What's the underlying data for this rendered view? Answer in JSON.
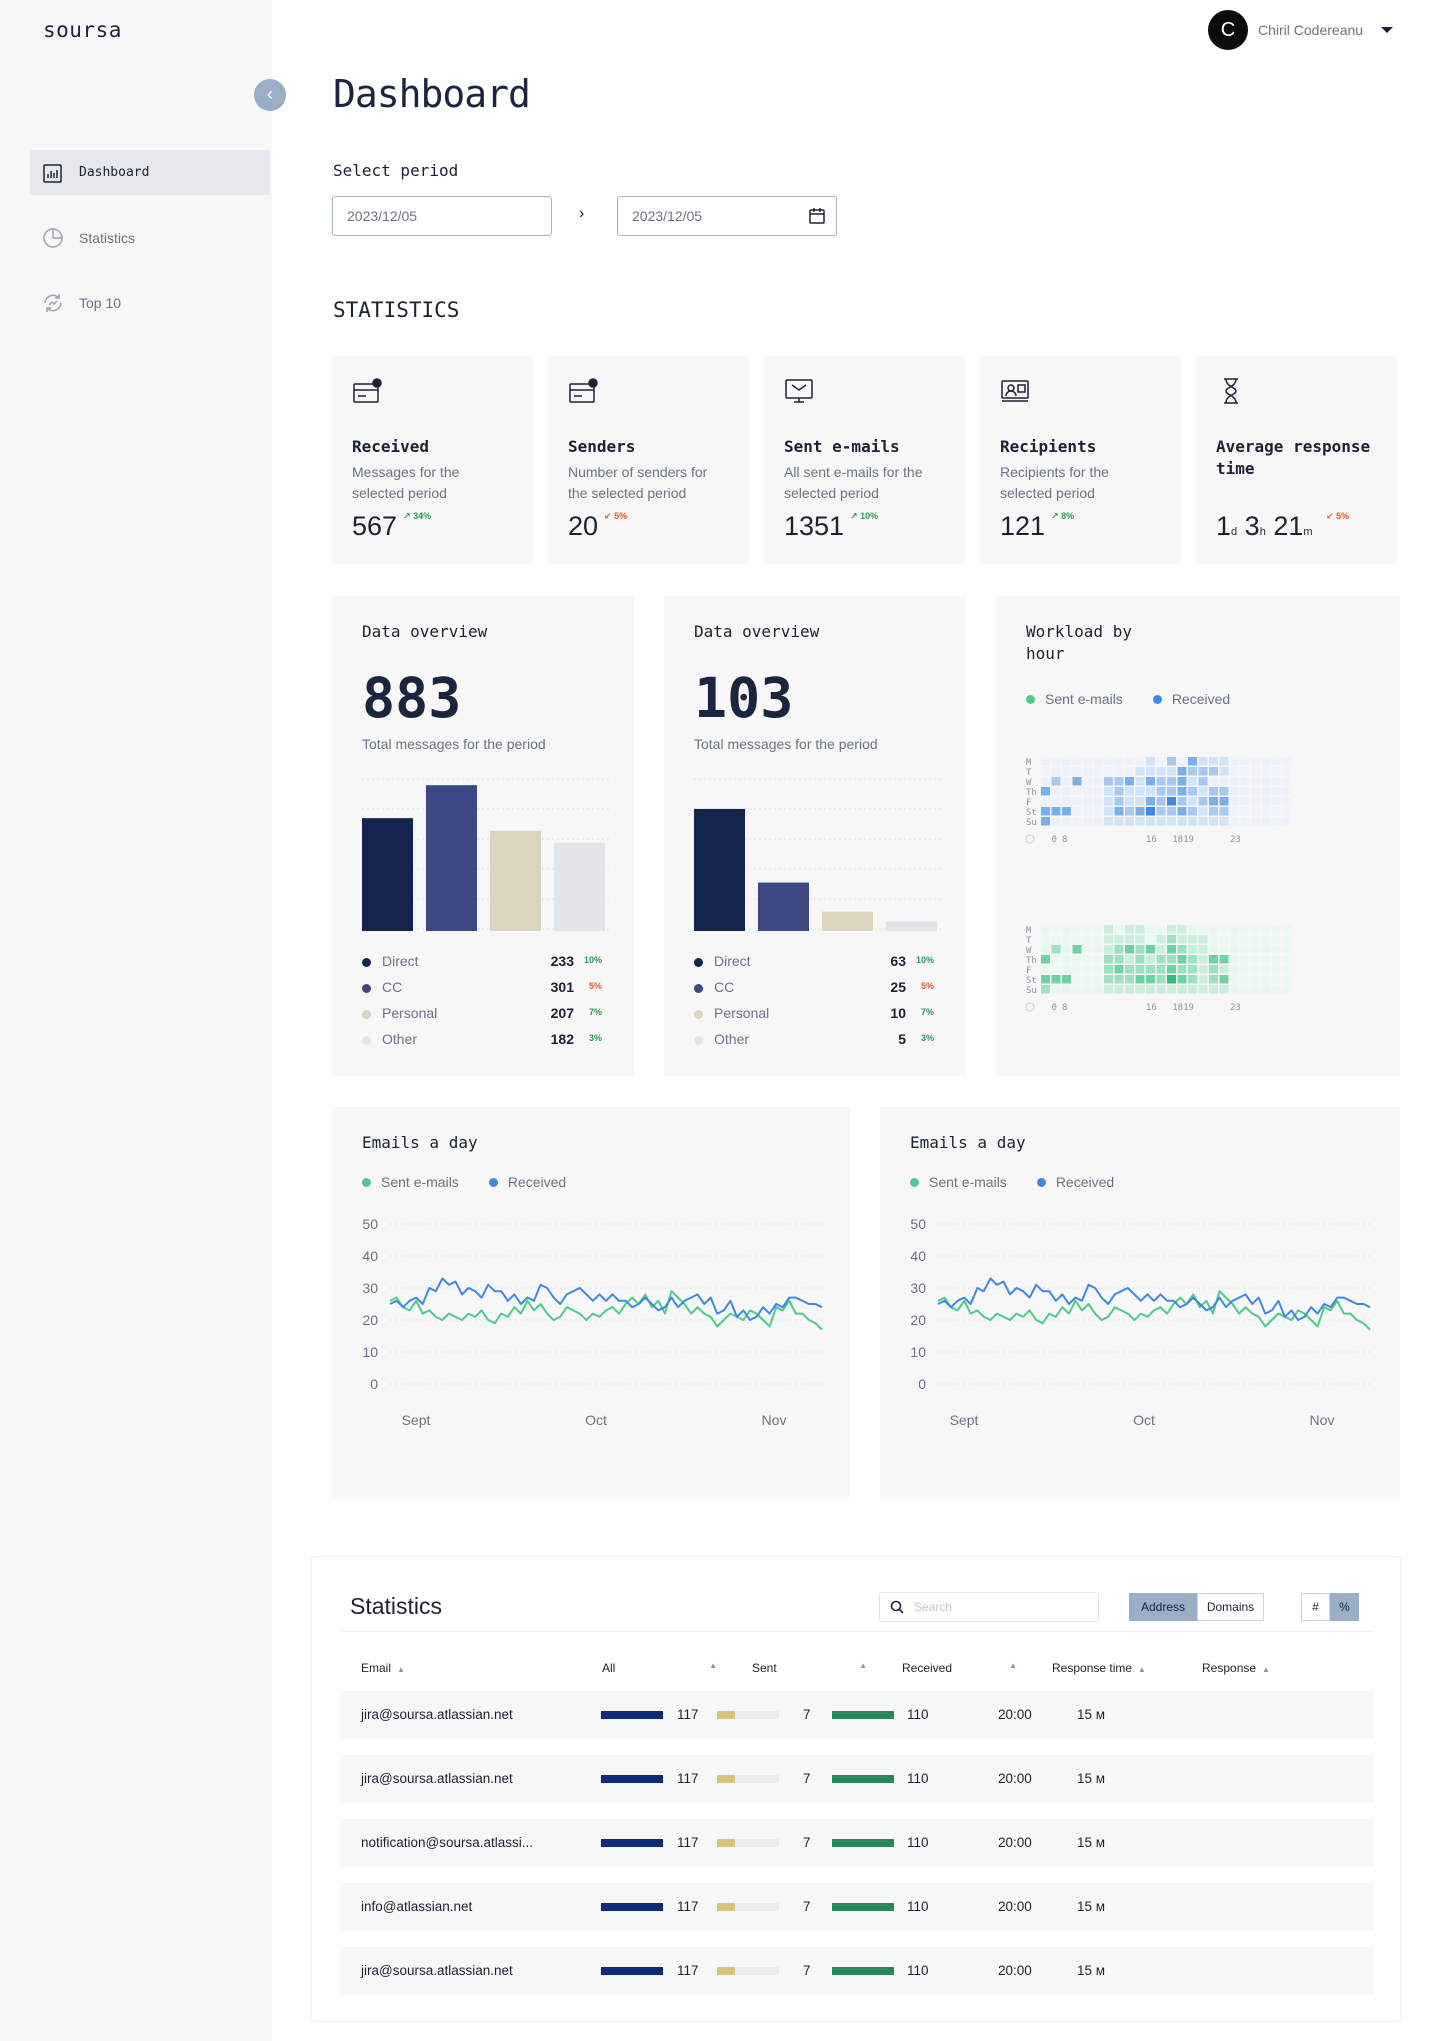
{
  "app": {
    "logo": "soursa",
    "user_initial": "C",
    "user_name": "Chiril Codereanu"
  },
  "sidebar": {
    "items": [
      {
        "label": "Dashboard",
        "icon": "report-icon"
      },
      {
        "label": "Statistics",
        "icon": "pie-chart-icon"
      },
      {
        "label": "Top 10",
        "icon": "refresh-chart-icon"
      }
    ]
  },
  "header": {
    "title": "Dashboard"
  },
  "period": {
    "label": "Select period",
    "from": "2023/12/05",
    "to": "2023/12/05",
    "arrow": "›"
  },
  "statistics": {
    "title": "STATISTICS",
    "cards": [
      {
        "title": "Received",
        "desc": "Messages for the selected period",
        "value": "567",
        "delta": "↗ 34%",
        "dir": "up"
      },
      {
        "title": "Senders",
        "desc": "Number of senders for the selected period",
        "value": "20",
        "delta": "↙ 5%",
        "dir": "down"
      },
      {
        "title": "Sent e-mails",
        "desc": "All sent e-mails for the selected period",
        "value": "1351",
        "delta": "↗ 10%",
        "dir": "up"
      },
      {
        "title": "Recipients",
        "desc": "Recipients for the selected period",
        "value": "121",
        "delta": "↗ 8%",
        "dir": "up"
      },
      {
        "title": "Average response time",
        "desc": "",
        "value_parts": [
          "1",
          "d",
          "3",
          "h",
          "21",
          "m"
        ],
        "delta": "↙ 5%",
        "dir": "down"
      }
    ]
  },
  "overview": [
    {
      "title": "Data overview",
      "total": "883",
      "subtitle": "Total messages for the period",
      "rows": [
        {
          "name": "Direct",
          "value": "233",
          "delta": "10%",
          "dir": "up"
        },
        {
          "name": "CC",
          "value": "301",
          "delta": "5%",
          "dir": "down"
        },
        {
          "name": "Personal",
          "value": "207",
          "delta": "7%",
          "dir": "up"
        },
        {
          "name": "Other",
          "value": "182",
          "delta": "3%",
          "dir": "up"
        }
      ]
    },
    {
      "title": "Data overview",
      "total": "103",
      "subtitle": "Total messages for the period",
      "rows": [
        {
          "name": "Direct",
          "value": "63",
          "delta": "10%",
          "dir": "up"
        },
        {
          "name": "CC",
          "value": "25",
          "delta": "5%",
          "dir": "down"
        },
        {
          "name": "Personal",
          "value": "10",
          "delta": "7%",
          "dir": "up"
        },
        {
          "name": "Other",
          "value": "5",
          "delta": "3%",
          "dir": "up"
        }
      ]
    }
  ],
  "workload": {
    "title": "Workload by hour",
    "legend": [
      "Sent e-mails",
      "Received"
    ],
    "days": [
      "M",
      "T",
      "W",
      "Th",
      "F",
      "St",
      "Su"
    ],
    "hour_labels": [
      "0",
      "8",
      "16",
      "1819",
      "23"
    ]
  },
  "emails_day": {
    "title": "Emails a day",
    "legend": [
      "Sent e-mails",
      "Received"
    ]
  },
  "colors": {
    "navy": "#14244f",
    "indigo": "#3d4783",
    "beige": "#dcd4bf",
    "gray": "#e2e5ea",
    "green": "#4ecb8d",
    "blue": "#3f8ae0",
    "bar_all": "#0f2a78",
    "bar_sent": "#d9c27a",
    "bar_recv": "#258a55"
  },
  "table": {
    "title": "Statistics",
    "search_placeholder": "Search",
    "seg1": [
      "Address",
      "Domains"
    ],
    "seg2": [
      "#",
      "%"
    ],
    "headers": [
      "Email",
      "All",
      "Sent",
      "Received",
      "Response time",
      "Response"
    ],
    "rows": [
      {
        "email": "jira@soursa.atlassian.net",
        "all": "117",
        "sent": "7",
        "received": "110",
        "rtime": "20:00",
        "resp": "15 м"
      },
      {
        "email": "jira@soursa.atlassian.net",
        "all": "117",
        "sent": "7",
        "received": "110",
        "rtime": "20:00",
        "resp": "15 м"
      },
      {
        "email": "notification@soursa.atlassi...",
        "all": "117",
        "sent": "7",
        "received": "110",
        "rtime": "20:00",
        "resp": "15 м"
      },
      {
        "email": "info@atlassian.net",
        "all": "117",
        "sent": "7",
        "received": "110",
        "rtime": "20:00",
        "resp": "15 м"
      },
      {
        "email": "jira@soursa.atlassian.net",
        "all": "117",
        "sent": "7",
        "received": "110",
        "rtime": "20:00",
        "resp": "15 м"
      }
    ]
  },
  "chart_data": [
    {
      "type": "bar",
      "categories": [
        "Direct",
        "CC",
        "Personal",
        "Other"
      ],
      "values": [
        233,
        301,
        207,
        182
      ],
      "ylim": [
        0,
        320
      ]
    },
    {
      "type": "bar",
      "categories": [
        "Direct",
        "CC",
        "Personal",
        "Other"
      ],
      "values": [
        63,
        25,
        10,
        5
      ],
      "ylim": [
        0,
        80
      ]
    },
    {
      "type": "heatmap",
      "rows": [
        "M",
        "T",
        "W",
        "Th",
        "F",
        "St",
        "Su"
      ],
      "x_ticks": [
        "0",
        "8",
        "16",
        "1819",
        "23"
      ],
      "series": [
        {
          "name": "Received",
          "values": [
            [
              0,
              0,
              0,
              0,
              0,
              0,
              0,
              0,
              0,
              0,
              1,
              0,
              2,
              0,
              3,
              1,
              1,
              1,
              0,
              0,
              0,
              0,
              0,
              0
            ],
            [
              0,
              0,
              0,
              0,
              0,
              0,
              0,
              0,
              0,
              1,
              1,
              1,
              1,
              3,
              2,
              2,
              2,
              1,
              0,
              0,
              0,
              0,
              0,
              0
            ],
            [
              0,
              2,
              0,
              3,
              0,
              0,
              2,
              2,
              3,
              1,
              3,
              2,
              2,
              3,
              1,
              2,
              0,
              0,
              0,
              0,
              0,
              0,
              0,
              0
            ],
            [
              3,
              0,
              0,
              0,
              0,
              0,
              1,
              2,
              1,
              1,
              1,
              2,
              2,
              3,
              2,
              1,
              2,
              2,
              0,
              0,
              0,
              0,
              0,
              0
            ],
            [
              0,
              0,
              0,
              0,
              0,
              0,
              1,
              2,
              1,
              1,
              3,
              2,
              4,
              2,
              1,
              2,
              3,
              3,
              0,
              0,
              0,
              0,
              0,
              0
            ],
            [
              3,
              3,
              3,
              0,
              0,
              0,
              1,
              3,
              2,
              3,
              4,
              2,
              2,
              3,
              2,
              1,
              2,
              2,
              0,
              0,
              0,
              0,
              0,
              0
            ],
            [
              3,
              0,
              0,
              0,
              0,
              0,
              1,
              1,
              1,
              1,
              1,
              1,
              1,
              1,
              1,
              1,
              1,
              1,
              0,
              0,
              0,
              0,
              0,
              0
            ]
          ]
        },
        {
          "name": "Sent e-mails",
          "values": [
            [
              0,
              0,
              0,
              0,
              0,
              0,
              1,
              0,
              1,
              1,
              0,
              0,
              1,
              1,
              0,
              0,
              0,
              0,
              0,
              0,
              0,
              0,
              0,
              0
            ],
            [
              0,
              0,
              0,
              0,
              0,
              0,
              1,
              1,
              1,
              1,
              0,
              1,
              2,
              1,
              1,
              1,
              0,
              0,
              0,
              0,
              0,
              0,
              0,
              0
            ],
            [
              0,
              2,
              0,
              3,
              0,
              0,
              1,
              2,
              3,
              2,
              3,
              1,
              3,
              2,
              1,
              1,
              0,
              0,
              0,
              0,
              0,
              0,
              0,
              0
            ],
            [
              3,
              0,
              0,
              0,
              0,
              0,
              2,
              2,
              1,
              2,
              1,
              2,
              2,
              3,
              2,
              1,
              3,
              3,
              0,
              0,
              0,
              0,
              0,
              0
            ],
            [
              0,
              0,
              0,
              0,
              0,
              0,
              2,
              3,
              2,
              2,
              2,
              2,
              3,
              2,
              2,
              1,
              2,
              1,
              0,
              0,
              0,
              0,
              0,
              0
            ],
            [
              3,
              3,
              3,
              0,
              0,
              0,
              2,
              2,
              2,
              3,
              3,
              2,
              4,
              3,
              2,
              1,
              2,
              3,
              0,
              0,
              0,
              0,
              0,
              0
            ],
            [
              2,
              0,
              0,
              0,
              0,
              0,
              1,
              1,
              1,
              1,
              1,
              1,
              1,
              1,
              1,
              1,
              1,
              1,
              0,
              0,
              0,
              0,
              0,
              0
            ]
          ]
        }
      ]
    },
    {
      "type": "line",
      "x_ticks": [
        "Sept",
        "Oct",
        "Nov"
      ],
      "ylim": [
        0,
        50
      ],
      "y_ticks": [
        0,
        10,
        20,
        30,
        40,
        50
      ],
      "series": [
        {
          "name": "Sent e-mails",
          "values": [
            26,
            27,
            24,
            23,
            26,
            22,
            23,
            21,
            20,
            22,
            21,
            20,
            22,
            21,
            23,
            20,
            19,
            22,
            21,
            24,
            22,
            26,
            23,
            25,
            22,
            20,
            21,
            24,
            23,
            22,
            20,
            22,
            21,
            23,
            24,
            22,
            25,
            27,
            25,
            28,
            24,
            26,
            22,
            29,
            27,
            25,
            22,
            24,
            22,
            21,
            18,
            20,
            22,
            21,
            20,
            23,
            22,
            20,
            18,
            24,
            23,
            26,
            22,
            22,
            20,
            19,
            17
          ]
        },
        {
          "name": "Received",
          "values": [
            25,
            26,
            24,
            26,
            27,
            25,
            30,
            29,
            33,
            31,
            32,
            28,
            30,
            29,
            27,
            31,
            29,
            29,
            26,
            28,
            25,
            27,
            26,
            31,
            30,
            27,
            25,
            28,
            29,
            30,
            28,
            26,
            28,
            26,
            28,
            26,
            26,
            24,
            25,
            27,
            25,
            23,
            24,
            27,
            24,
            26,
            27,
            28,
            25,
            27,
            22,
            23,
            26,
            21,
            23,
            20,
            21,
            24,
            22,
            25,
            24,
            27,
            27,
            26,
            25,
            25,
            24
          ]
        }
      ]
    },
    {
      "type": "line",
      "x_ticks": [
        "Sept",
        "Oct",
        "Nov"
      ],
      "ylim": [
        0,
        50
      ],
      "y_ticks": [
        0,
        10,
        20,
        30,
        40,
        50
      ],
      "series": [
        {
          "name": "Sent e-mails",
          "values": [
            26,
            27,
            24,
            23,
            26,
            22,
            23,
            21,
            20,
            22,
            21,
            20,
            22,
            21,
            23,
            20,
            19,
            22,
            21,
            24,
            22,
            26,
            23,
            25,
            22,
            20,
            21,
            24,
            23,
            22,
            20,
            22,
            21,
            23,
            24,
            22,
            25,
            27,
            25,
            28,
            24,
            26,
            22,
            29,
            27,
            25,
            22,
            24,
            22,
            21,
            18,
            20,
            22,
            21,
            20,
            23,
            22,
            20,
            18,
            24,
            23,
            26,
            22,
            22,
            20,
            19,
            17
          ]
        },
        {
          "name": "Received",
          "values": [
            25,
            26,
            24,
            26,
            27,
            25,
            30,
            29,
            33,
            31,
            32,
            28,
            30,
            29,
            27,
            31,
            29,
            29,
            26,
            28,
            25,
            27,
            26,
            31,
            30,
            27,
            25,
            28,
            29,
            30,
            28,
            26,
            28,
            26,
            28,
            26,
            26,
            24,
            25,
            27,
            25,
            23,
            24,
            27,
            24,
            26,
            27,
            28,
            25,
            27,
            22,
            23,
            26,
            21,
            23,
            20,
            21,
            24,
            22,
            25,
            24,
            27,
            27,
            26,
            25,
            25,
            24
          ]
        }
      ]
    }
  ]
}
